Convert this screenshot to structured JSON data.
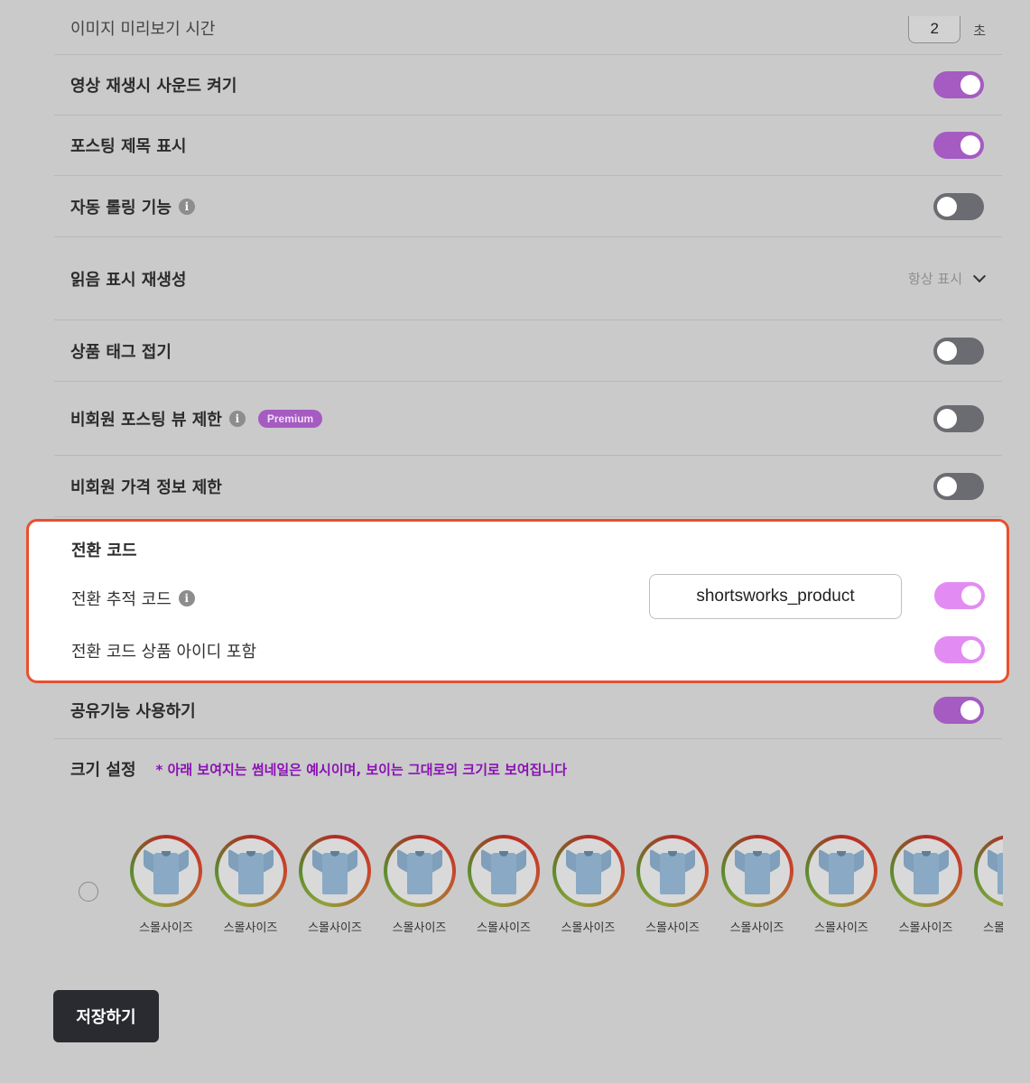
{
  "rows": {
    "preview_time": {
      "label": "이미지 미리보기 시간",
      "value": "2",
      "unit": "초"
    },
    "video_sound": {
      "label": "영상 재생시 사운드 켜기",
      "enabled": true
    },
    "posting_title": {
      "label": "포스팅 제목 표시",
      "enabled": true
    },
    "auto_rolling": {
      "label": "자동 롤링 기능",
      "enabled": false
    },
    "read_indicator": {
      "label": "읽음 표시 재생성",
      "selected": "항상 표시"
    },
    "tag_fold": {
      "label": "상품 태그 접기",
      "enabled": false
    },
    "guest_view_limit": {
      "label": "비회원 포스팅 뷰 제한",
      "badge": "Premium",
      "enabled": false
    },
    "guest_price_limit": {
      "label": "비회원 가격 정보 제한",
      "enabled": false
    },
    "share": {
      "label": "공유기능 사용하기",
      "enabled": true
    }
  },
  "conversion": {
    "title": "전환 코드",
    "tracking_label": "전환 추적 코드",
    "tracking_value": "shortsworks_product",
    "tracking_enabled": true,
    "include_id_label": "전환 코드 상품 아이디 포함",
    "include_id_enabled": true
  },
  "size_setting": {
    "label": "크기 설정",
    "note": "* 아래 보여지는 썸네일은 예시이며, 보이는 그대로의 크기로 보여집니다",
    "thumb_caption": "스몰사이즈",
    "thumb_count": 11
  },
  "save_label": "저장하기",
  "colors": {
    "toggle_on": "#a55bc1",
    "toggle_on_bright": "#e28cf3",
    "toggle_off": "#6a6c72",
    "highlight_border": "#e8502d",
    "note_text": "#8a10b5"
  }
}
